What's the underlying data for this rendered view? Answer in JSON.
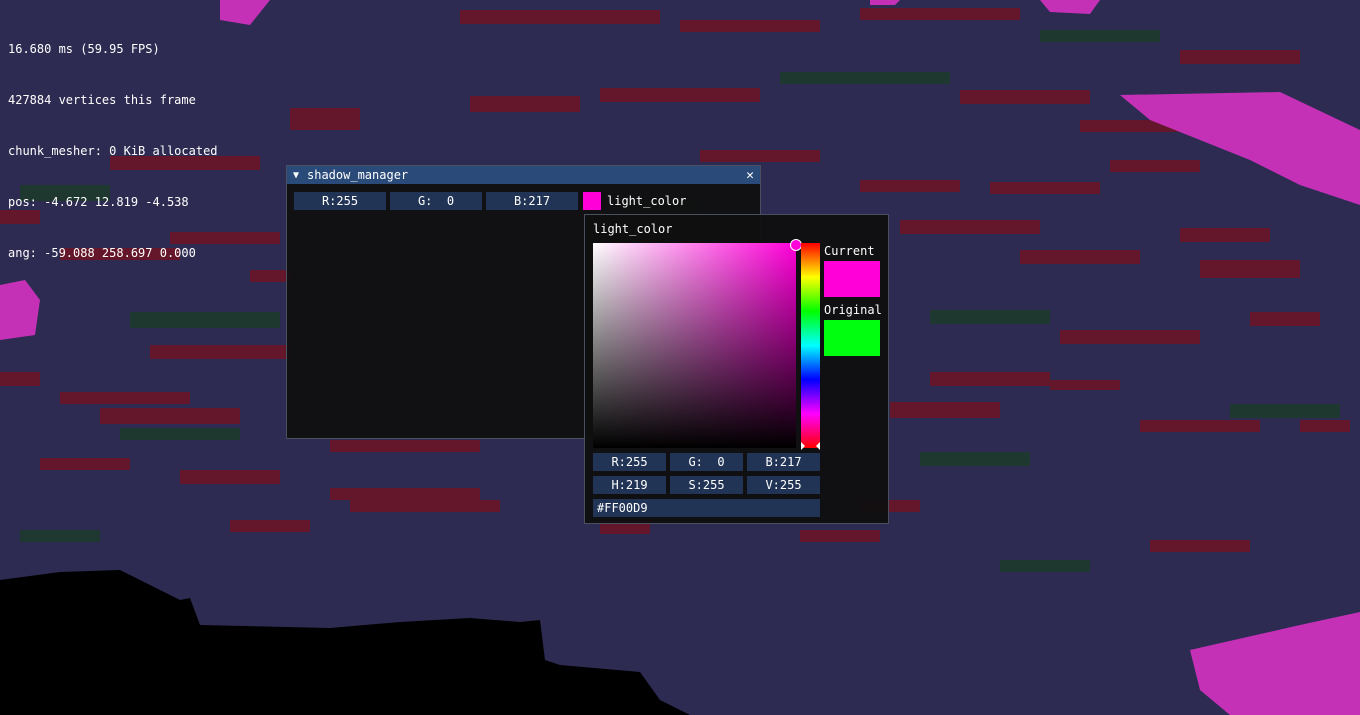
{
  "stats": {
    "frame_time": "16.680 ms (59.95 FPS)",
    "vertices": "427884 vertices this frame",
    "mesher": "chunk_mesher: 0 KiB allocated",
    "pos": "pos: -4.672 12.819 -4.538",
    "ang": "ang: -59.088 258.697 0.000"
  },
  "window": {
    "collapse_glyph": "▼",
    "title": "shadow_manager",
    "close_glyph": "✕",
    "r": "R:255",
    "g": "G:  0",
    "b": "B:217",
    "label": "light_color"
  },
  "picker": {
    "title": "light_color",
    "current_label": "Current",
    "original_label": "Original",
    "r": "R:255",
    "g": "G:  0",
    "b": "B:217",
    "h": "H:219",
    "s": "S:255",
    "v": "V:255",
    "hex": "#FF00D9"
  },
  "colors": {
    "current": "#ff00d9",
    "original": "#00ff0f",
    "sv_hue": "#ff00d9",
    "sky": "#2e2b52",
    "ground_blue": "#2a2750",
    "ground_dark": "#24213f",
    "ledge_red": "#6a1526",
    "ledge_green": "#1d3a2c",
    "magenta_block": "#c431b7",
    "void": "#000000"
  }
}
